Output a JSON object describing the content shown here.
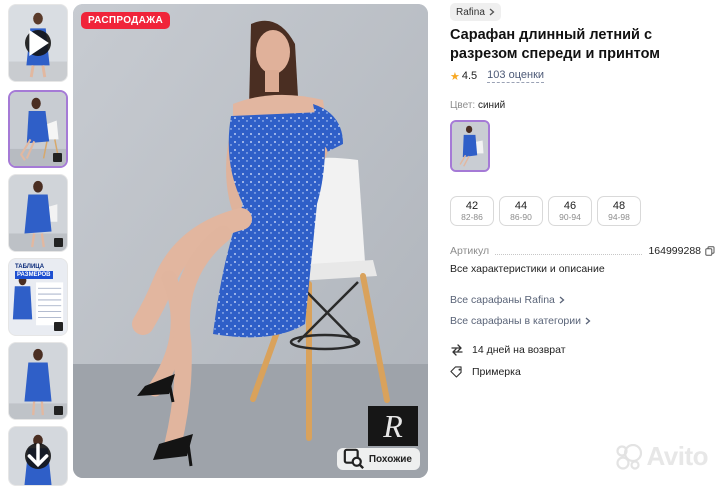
{
  "gallery": {
    "sale_badge": "РАСПРОДАЖА",
    "similar_button": "Похожие",
    "watermark_letter": "R",
    "size_chart_thumb_title": "ТАБЛИЦА",
    "size_chart_thumb_subtitle": "РАЗМЕРОВ",
    "thumbnails": [
      {
        "type": "video",
        "icon": "play-icon"
      },
      {
        "type": "photo",
        "selected": true
      },
      {
        "type": "photo"
      },
      {
        "type": "size-chart"
      },
      {
        "type": "photo"
      },
      {
        "type": "photo",
        "icon": "arrow-down-icon"
      }
    ]
  },
  "product": {
    "seller": "Rafina",
    "title": "Сарафан длинный летний с разрезом спереди и принтом",
    "rating": "4.5",
    "reviews": "103 оценки",
    "color_label": "Цвет:",
    "color_value": "синий",
    "sizes": [
      {
        "size": "42",
        "range": "82-86"
      },
      {
        "size": "44",
        "range": "86-90"
      },
      {
        "size": "46",
        "range": "90-94"
      },
      {
        "size": "48",
        "range": "94-98"
      }
    ],
    "article_label": "Артикул",
    "article_value": "164999288",
    "all_specs": "Все характеристики и описание",
    "links": {
      "seller_sarafans": "Все сарафаны Rafina",
      "category_sarafans": "Все сарафаны в категории"
    },
    "features": {
      "returns": "14 дней на возврат",
      "try_on": "Примерка"
    }
  },
  "watermark": "Avito",
  "colors": {
    "accent_border": "#a57ad6",
    "sale_red": "#f0243a",
    "star": "#f7a823",
    "dress_blue": "#2f5fc8"
  }
}
